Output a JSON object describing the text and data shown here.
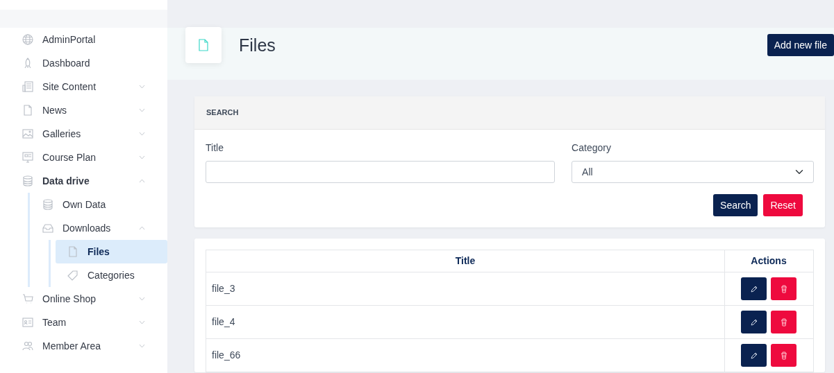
{
  "sidebar": {
    "items": [
      {
        "label": "AdminPortal",
        "selected": false
      },
      {
        "label": "Dashboard",
        "selected": false
      },
      {
        "label": "Site Content",
        "expanded": false,
        "selected": false
      },
      {
        "label": "News",
        "expanded": false,
        "selected": false
      },
      {
        "label": "Galleries",
        "expanded": false,
        "selected": false
      },
      {
        "label": "Course Plan",
        "expanded": false,
        "selected": false
      },
      {
        "label": "Data drive",
        "expanded": true,
        "selected": false,
        "children": [
          {
            "label": "Own Data",
            "selected": false
          },
          {
            "label": "Downloads",
            "expanded": true,
            "selected": false,
            "children": [
              {
                "label": "Files",
                "selected": true
              },
              {
                "label": "Categories",
                "selected": false
              }
            ]
          }
        ]
      },
      {
        "label": "Online Shop",
        "expanded": false,
        "selected": false
      },
      {
        "label": "Team",
        "expanded": false,
        "selected": false
      },
      {
        "label": "Member Area",
        "expanded": false,
        "selected": false
      }
    ]
  },
  "header": {
    "title": "Files",
    "add_button": "Add new file"
  },
  "search": {
    "heading": "SEARCH",
    "fields": [
      {
        "label": "Title",
        "kind": "text"
      },
      {
        "label": "Category",
        "kind": "select",
        "value": "All"
      }
    ],
    "buttons": [
      {
        "label": "Search",
        "kind": "primary"
      },
      {
        "label": "Reset",
        "kind": "danger"
      }
    ]
  },
  "table": {
    "columns": [
      "Title",
      "Actions"
    ],
    "rows": [
      {
        "title": "file_3"
      },
      {
        "title": "file_4"
      },
      {
        "title": "file_66"
      }
    ]
  }
}
